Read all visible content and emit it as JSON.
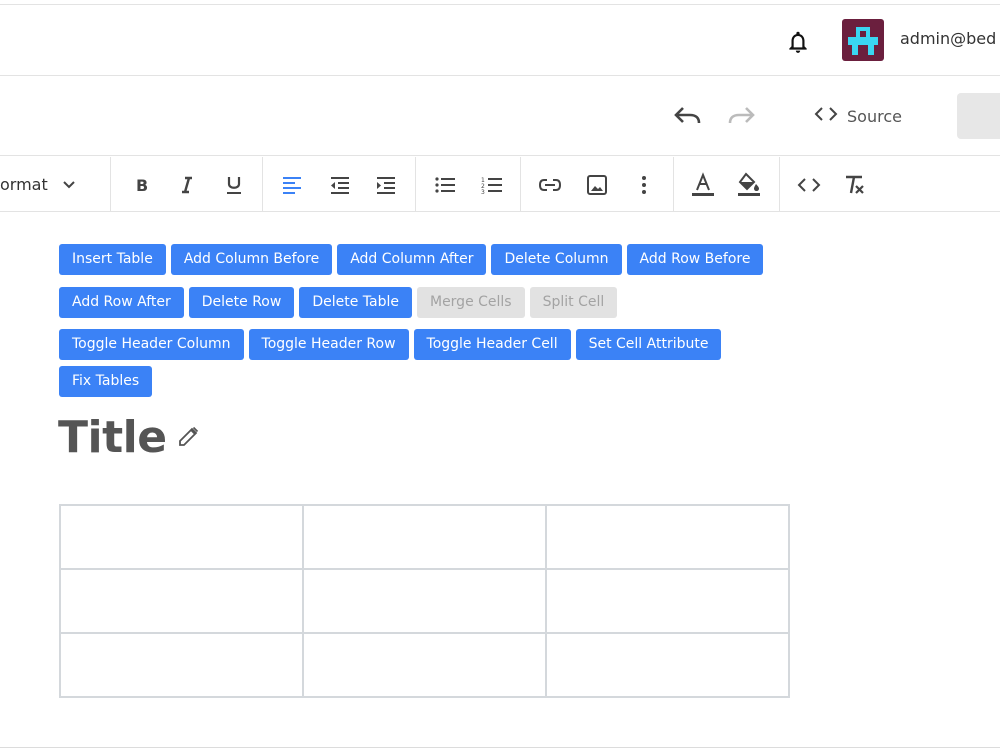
{
  "header": {
    "user_email": "admin@bed"
  },
  "editor": {
    "source_label": "Source",
    "format_label": "ormat"
  },
  "table_buttons": {
    "row1": [
      "Insert Table",
      "Add Column Before",
      "Add Column After",
      "Delete Column",
      "Add Row Before"
    ],
    "row2": [
      "Add Row After",
      "Delete Row",
      "Delete Table",
      "Merge Cells",
      "Split Cell"
    ],
    "row3": [
      "Toggle Header Column",
      "Toggle Header Row",
      "Toggle Header Cell",
      "Set Cell Attribute"
    ],
    "row4": [
      "Fix Tables"
    ],
    "disabled": [
      "Merge Cells",
      "Split Cell"
    ]
  },
  "document": {
    "title": "Title",
    "table": {
      "rows": 3,
      "cols": 3
    }
  },
  "toolbar_icons": [
    "bold-icon",
    "italic-icon",
    "underline-icon",
    "align-left-icon",
    "outdent-icon",
    "indent-icon",
    "bullet-list-icon",
    "numbered-list-icon",
    "link-icon",
    "image-icon",
    "more-vertical-icon",
    "text-color-icon",
    "highlight-color-icon",
    "code-icon",
    "clear-format-icon"
  ],
  "colors": {
    "accent": "#3b82f6",
    "active_icon": "#3b82f6",
    "disabled_bg": "#e2e2e2",
    "avatar_bg": "#6b1f3e"
  }
}
